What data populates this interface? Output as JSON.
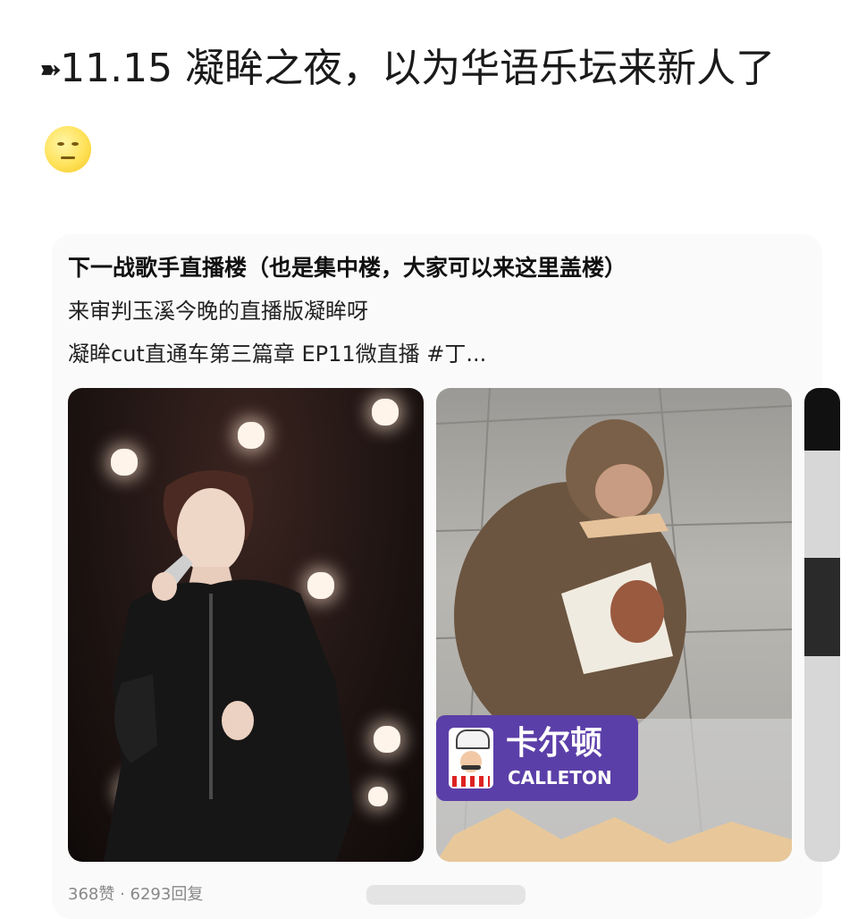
{
  "headline": {
    "arrow": "➽",
    "text": "11.15 凝眸之夜，以为华语乐坛来新人了"
  },
  "post": {
    "title": "下一战歌手直播楼（也是集中楼，大家可以来这里盖楼）",
    "line1": "来审判玉溪今晚的直播版凝眸呀",
    "line2": "凝眸cut直通车第三篇章 EP11微直播 #丁..."
  },
  "sticker": {
    "brand_cn": "卡尔顿",
    "brand_en": "CALLETON"
  },
  "stats": "368赞 · 6293回复"
}
